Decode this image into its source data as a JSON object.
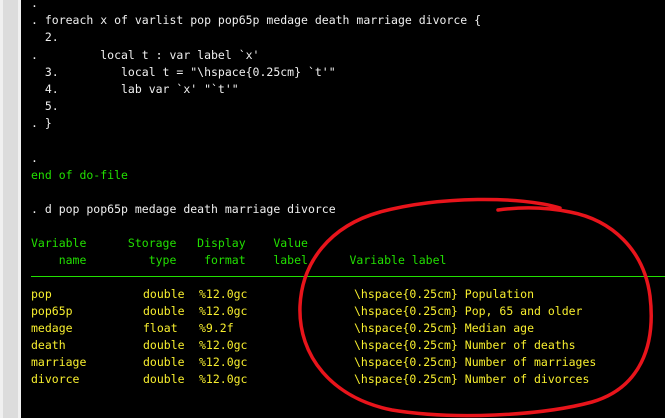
{
  "code": {
    "l1": ".",
    "l2": ". foreach x of varlist pop pop65p medage death marriage divorce {",
    "l3": "  2.",
    "l4": ".         local t : var label `x'",
    "l5": "  3.         local t = \"\\hspace{0.25cm} `t'\"",
    "l6": "  4.         lab var `x' \"`t'\"",
    "l7": "  5.",
    "l8": ". }",
    "l9": ".",
    "l10": "end of do-file",
    "l11": ". d pop pop65p medage death marriage divorce"
  },
  "table": {
    "header1": "Variable      Storage   Display    Value",
    "header2": "    name         type    format    label      Variable label",
    "rows": [
      {
        "name": "pop",
        "type": "double",
        "format": "%12.0gc",
        "label": "\\hspace{0.25cm} Population"
      },
      {
        "name": "pop65p",
        "type": "double",
        "format": "%12.0gc",
        "label": "\\hspace{0.25cm} Pop, 65 and older"
      },
      {
        "name": "medage",
        "type": "float",
        "format": "%9.2f",
        "label": "\\hspace{0.25cm} Median age"
      },
      {
        "name": "death",
        "type": "double",
        "format": "%12.0gc",
        "label": "\\hspace{0.25cm} Number of deaths"
      },
      {
        "name": "marriage",
        "type": "double",
        "format": "%12.0gc",
        "label": "\\hspace{0.25cm} Number of marriages"
      },
      {
        "name": "divorce",
        "type": "double",
        "format": "%12.0gc",
        "label": "\\hspace{0.25cm} Number of divorces"
      }
    ]
  },
  "colors": {
    "background": "#000000",
    "command_text": "#f0f0f0",
    "output_text": "#22e000",
    "result_text": "#f8ef2e",
    "annotation": "#e8141b"
  }
}
